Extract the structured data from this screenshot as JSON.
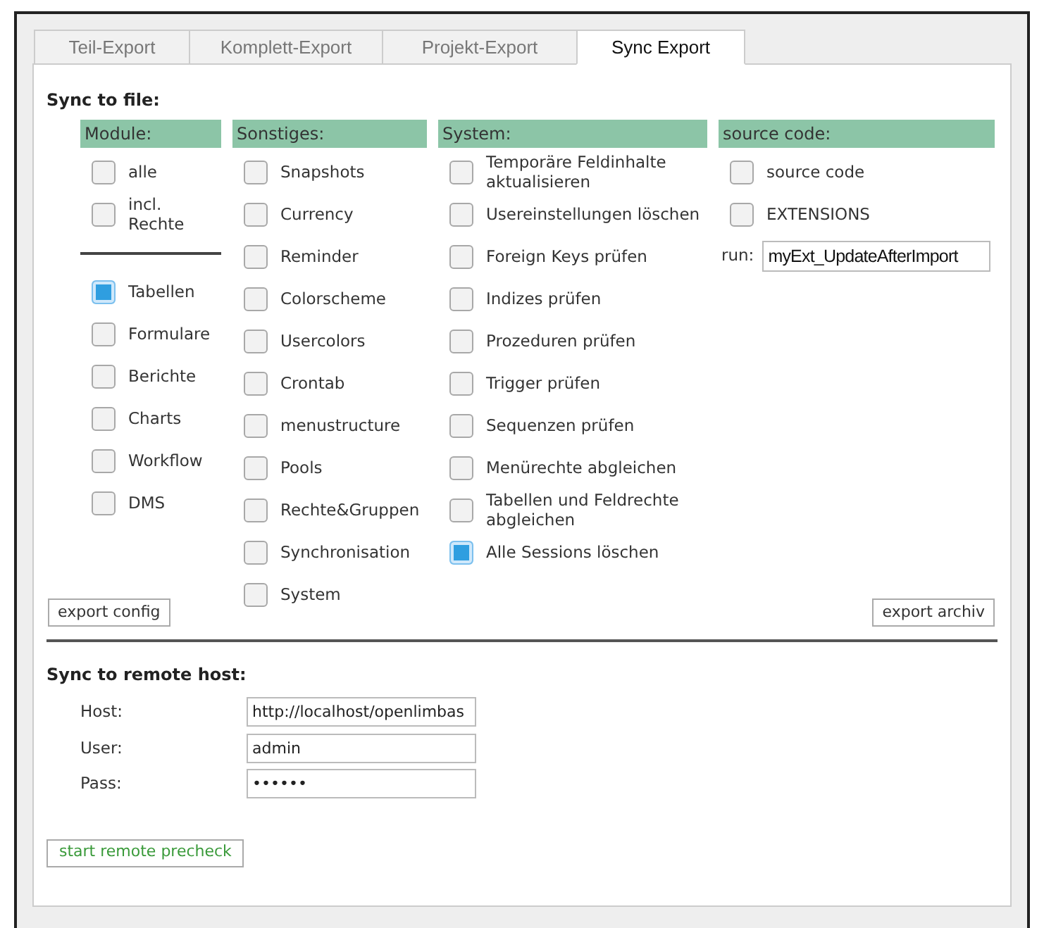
{
  "tabs": [
    {
      "label": "Teil-Export",
      "selected": false
    },
    {
      "label": "Komplett-Export",
      "selected": false
    },
    {
      "label": "Projekt-Export",
      "selected": false
    },
    {
      "label": "Sync Export",
      "selected": true
    }
  ],
  "sync_to_file": {
    "title": "Sync to file:",
    "columns": [
      {
        "header": "Module:",
        "items": [
          {
            "kind": "checkbox",
            "label": "alle",
            "checked": false
          },
          {
            "kind": "checkbox",
            "label": "incl. Rechte",
            "checked": false
          },
          {
            "kind": "divider"
          },
          {
            "kind": "checkbox",
            "label": "Tabellen",
            "checked": true
          },
          {
            "kind": "checkbox",
            "label": "Formulare",
            "checked": false
          },
          {
            "kind": "checkbox",
            "label": "Berichte",
            "checked": false
          },
          {
            "kind": "checkbox",
            "label": "Charts",
            "checked": false
          },
          {
            "kind": "checkbox",
            "label": "Workflow",
            "checked": false
          },
          {
            "kind": "checkbox",
            "label": "DMS",
            "checked": false
          }
        ]
      },
      {
        "header": "Sonstiges:",
        "items": [
          {
            "kind": "checkbox",
            "label": "Snapshots",
            "checked": false
          },
          {
            "kind": "checkbox",
            "label": "Currency",
            "checked": false
          },
          {
            "kind": "checkbox",
            "label": "Reminder",
            "checked": false
          },
          {
            "kind": "checkbox",
            "label": "Colorscheme",
            "checked": false
          },
          {
            "kind": "checkbox",
            "label": "Usercolors",
            "checked": false
          },
          {
            "kind": "checkbox",
            "label": "Crontab",
            "checked": false
          },
          {
            "kind": "checkbox",
            "label": "menustructure",
            "checked": false
          },
          {
            "kind": "checkbox",
            "label": "Pools",
            "checked": false
          },
          {
            "kind": "checkbox",
            "label": "Rechte&Gruppen",
            "checked": false
          },
          {
            "kind": "checkbox",
            "label": "Synchronisation",
            "checked": false
          },
          {
            "kind": "checkbox",
            "label": "System",
            "checked": false
          }
        ]
      },
      {
        "header": "System:",
        "items": [
          {
            "kind": "checkbox",
            "label": "Temporäre Feldinhalte aktualisieren",
            "checked": false
          },
          {
            "kind": "checkbox",
            "label": "Usereinstellungen löschen",
            "checked": false
          },
          {
            "kind": "checkbox",
            "label": "Foreign Keys prüfen",
            "checked": false
          },
          {
            "kind": "checkbox",
            "label": "Indizes prüfen",
            "checked": false
          },
          {
            "kind": "checkbox",
            "label": "Prozeduren prüfen",
            "checked": false
          },
          {
            "kind": "checkbox",
            "label": "Trigger prüfen",
            "checked": false
          },
          {
            "kind": "checkbox",
            "label": "Sequenzen prüfen",
            "checked": false
          },
          {
            "kind": "checkbox",
            "label": "Menürechte abgleichen",
            "checked": false
          },
          {
            "kind": "checkbox",
            "label": "Tabellen und Feldrechte abgleichen",
            "checked": false
          },
          {
            "kind": "checkbox",
            "label": "Alle Sessions löschen",
            "checked": true
          }
        ]
      },
      {
        "header": "source code:",
        "items": [
          {
            "kind": "checkbox",
            "label": "source code",
            "checked": false
          },
          {
            "kind": "checkbox",
            "label": "EXTENSIONS",
            "checked": false
          },
          {
            "kind": "field",
            "label": "run:",
            "value": "myExt_UpdateAfterImport"
          }
        ]
      }
    ],
    "buttons": [
      "export config",
      "export archiv"
    ]
  },
  "sync_to_remote": {
    "title": "Sync to remote host:",
    "fields": [
      {
        "label": "Host:",
        "value": "http://localhost/openlimbas"
      },
      {
        "label": "User:",
        "value": "admin"
      },
      {
        "label": "Pass:",
        "value": "••••••"
      }
    ],
    "button": "start remote precheck"
  }
}
